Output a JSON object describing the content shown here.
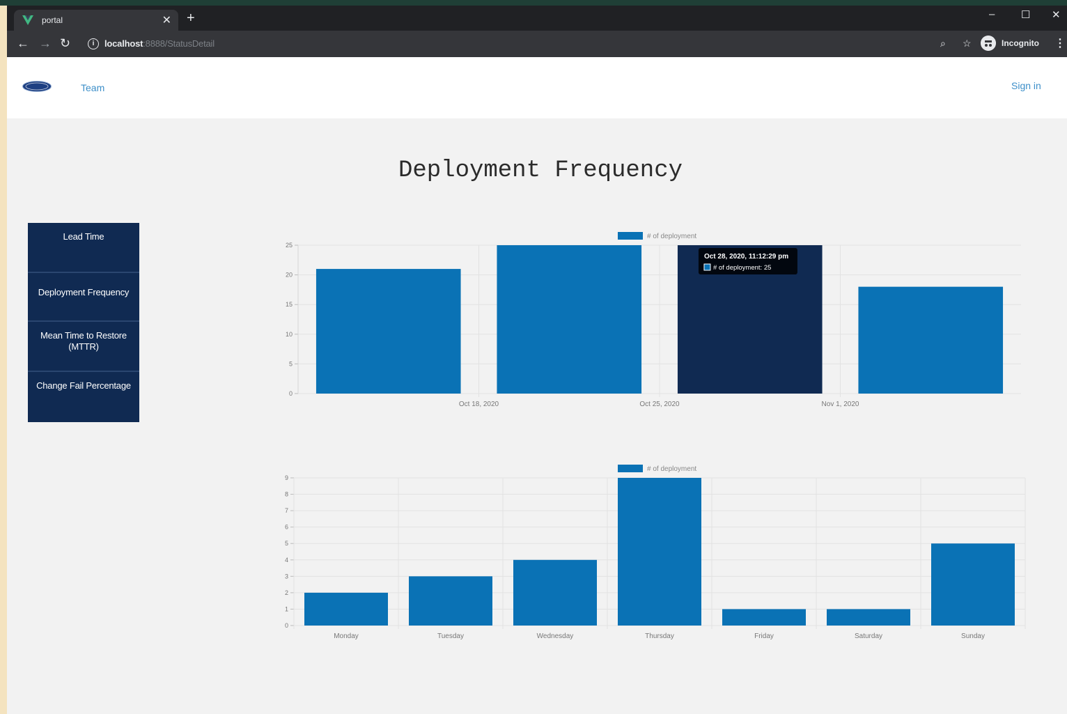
{
  "browser": {
    "tab_title": "portal",
    "url_host": "localhost",
    "url_path": ":8888/StatusDetail",
    "profile_label": "Incognito"
  },
  "nav": {
    "team_label": "Team",
    "signin_label": "Sign in"
  },
  "page": {
    "title": "Deployment Frequency"
  },
  "sidebar": {
    "items": [
      {
        "label": "Lead Time"
      },
      {
        "label": "Deployment Frequency"
      },
      {
        "label": "Mean Time to Restore (MTTR)"
      },
      {
        "label": "Change Fail Percentage"
      }
    ]
  },
  "colors": {
    "bar": "#0a72b5",
    "bar_highlight": "#102a52",
    "sidebar_bg": "#102a52"
  },
  "chart_data": [
    {
      "type": "bar",
      "legend": "# of deployment",
      "x_tick_labels": [
        "Oct 18, 2020",
        "Oct 25, 2020",
        "Nov 1, 2020"
      ],
      "values": [
        21,
        25,
        25,
        18
      ],
      "ylim": [
        0,
        25
      ],
      "yticks": [
        0,
        5,
        10,
        15,
        20,
        25
      ],
      "grid": true,
      "highlighted_index": 2,
      "tooltip": {
        "title": "Oct 28, 2020, 11:12:29 pm",
        "body": "# of deployment: 25"
      }
    },
    {
      "type": "bar",
      "legend": "# of deployment",
      "categories": [
        "Monday",
        "Tuesday",
        "Wednesday",
        "Thursday",
        "Friday",
        "Saturday",
        "Sunday"
      ],
      "values": [
        2,
        3,
        4,
        9,
        1,
        1,
        5
      ],
      "ylim": [
        0,
        9
      ],
      "yticks": [
        0,
        1,
        2,
        3,
        4,
        5,
        6,
        7,
        8,
        9
      ],
      "grid": true
    }
  ]
}
